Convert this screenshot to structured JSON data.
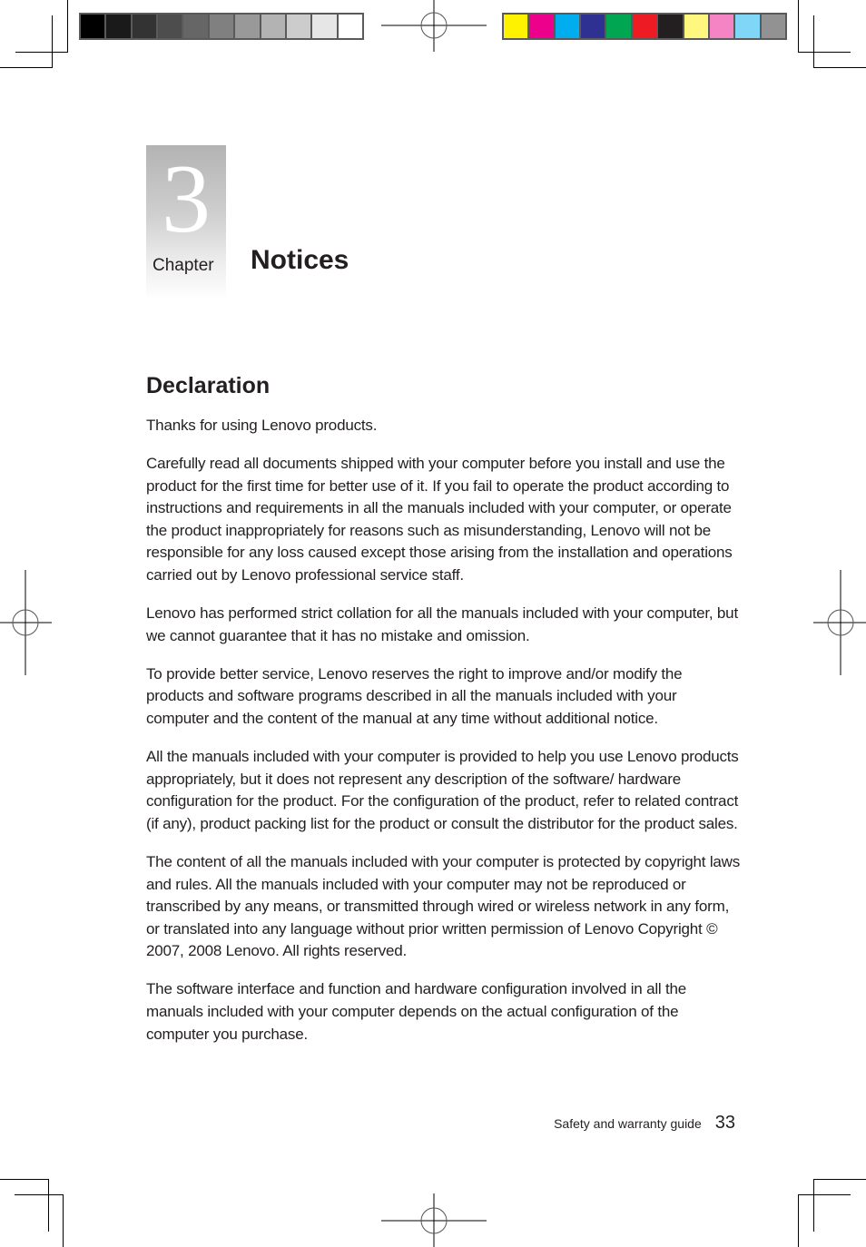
{
  "print_marks": {
    "grayscale_bar": [
      "#000000",
      "#1a1a1a",
      "#333333",
      "#4d4d4d",
      "#666666",
      "#808080",
      "#999999",
      "#b3b3b3",
      "#cccccc",
      "#e6e6e6",
      "#ffffff"
    ],
    "color_bar": [
      "#fff200",
      "#ec008c",
      "#00aeef",
      "#2e3192",
      "#00a651",
      "#ed1c24",
      "#231f20",
      "#fff77e",
      "#f584c4",
      "#7fd6f7",
      "#929292"
    ]
  },
  "chapter": {
    "number": "3",
    "label": "Chapter",
    "title": "Notices"
  },
  "section": {
    "title": "Declaration",
    "paragraphs": [
      "Thanks for using Lenovo products.",
      "Carefully read all documents shipped with your computer before you install and use the product for the first time for better use of it. If you fail to operate the product according to instructions and requirements in all the manuals included with your computer, or operate the product inappropriately for reasons such as misunderstanding, Lenovo will not be responsible for any loss caused except those arising from the installation and operations carried out by Lenovo professional service staff.",
      "Lenovo has performed strict collation for all the manuals included with your computer, but we cannot guarantee that it has no mistake and omission.",
      "To provide better service, Lenovo reserves the right to improve and/or modify the products and software programs described in all the manuals included with your computer and the content of the manual at any time without additional notice.",
      "All the manuals included with your computer is provided to help you use Lenovo products appropriately, but it does not represent any description of the software/ hardware configuration for the product. For the configuration of the product, refer to related contract (if any), product packing list for the product or consult the distributor for the product sales.",
      "The content of all the manuals included with your computer is protected by copyright laws and rules. All the manuals included with your computer may not be reproduced or transcribed by any means, or transmitted through wired or wireless network in any form, or translated into any language without prior written permission of Lenovo Copyright © 2007, 2008 Lenovo. All rights reserved.",
      "The software interface and function and hardware configuration involved in all the manuals included with your computer depends on the actual configuration of the computer you purchase."
    ]
  },
  "footer": {
    "guide_title": "Safety and warranty guide",
    "page_number": "33"
  }
}
